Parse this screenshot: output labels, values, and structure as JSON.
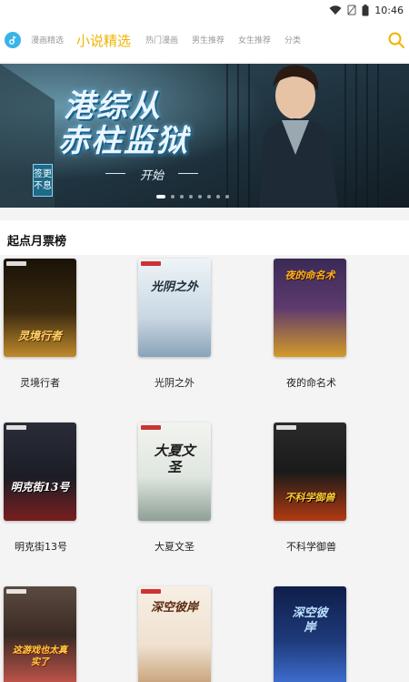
{
  "status": {
    "time": "10:46"
  },
  "nav": {
    "tabs": [
      "漫画精选",
      "小说精选",
      "热门漫画",
      "男生推荐",
      "女生推荐",
      "分类"
    ],
    "active_index": 1
  },
  "banner": {
    "title_line1": "港综从",
    "title_line2": "赤柱监狱",
    "subtitle": "开始",
    "side_tag": "签更不息"
  },
  "section": {
    "title": "起点月票榜"
  },
  "books": [
    {
      "title": "灵境行者",
      "cover_text": "灵境行者",
      "colors": [
        "#1a1208",
        "#c08a2c"
      ]
    },
    {
      "title": "光阴之外",
      "cover_text": "光阴之外",
      "colors": [
        "#dfe9f2",
        "#9bb4c6"
      ]
    },
    {
      "title": "夜的命名术",
      "cover_text": "夜的命名术",
      "colors": [
        "#2a1d3f",
        "#e0a020"
      ]
    },
    {
      "title": "明克街13号",
      "cover_text": "明克街13号",
      "colors": [
        "#1b1d26",
        "#7a1e1e"
      ]
    },
    {
      "title": "大夏文圣",
      "cover_text": "大夏文圣",
      "colors": [
        "#e8eee9",
        "#8fa096"
      ]
    },
    {
      "title": "不科学御兽",
      "cover_text": "不科学御兽",
      "colors": [
        "#1a1a1a",
        "#b23a12"
      ]
    },
    {
      "title": "",
      "cover_text": "这游戏也太真实了",
      "colors": [
        "#3a2a24",
        "#c2554a"
      ]
    },
    {
      "title": "",
      "cover_text": "深空彼岸",
      "colors": [
        "#f4ebe0",
        "#c8a27a"
      ]
    },
    {
      "title": "",
      "cover_text": "深空彼岸",
      "colors": [
        "#0f1e4a",
        "#3e6fd1"
      ]
    }
  ]
}
